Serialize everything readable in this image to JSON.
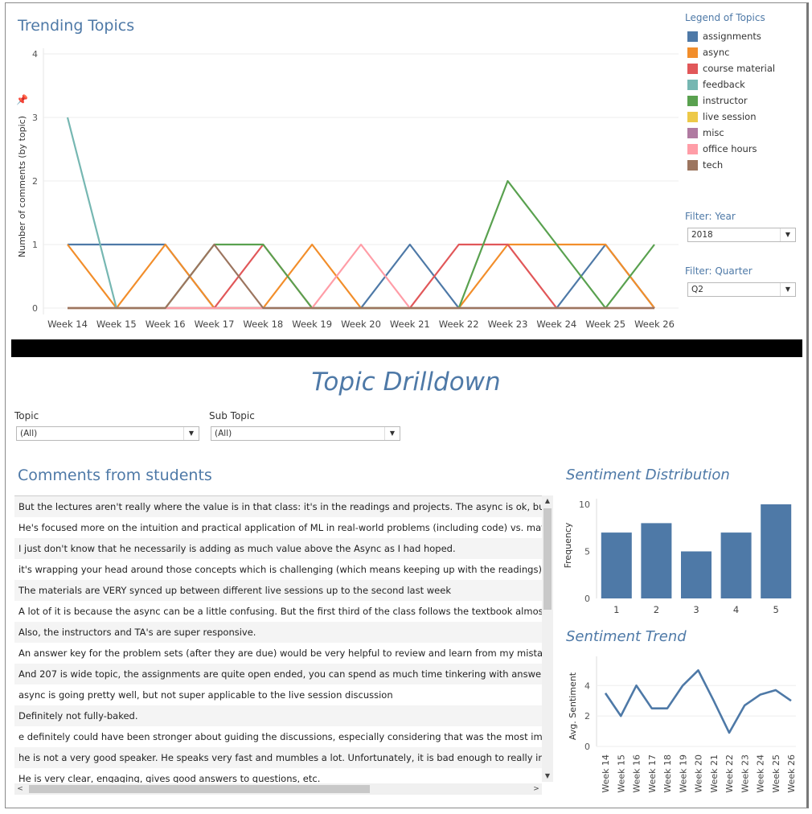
{
  "trending": {
    "title": "Trending Topics"
  },
  "legend": {
    "title": "Legend of Topics",
    "items": [
      {
        "label": "assignments",
        "color": "#4e79a7"
      },
      {
        "label": "async",
        "color": "#f28e2b"
      },
      {
        "label": "course material",
        "color": "#e15759"
      },
      {
        "label": "feedback",
        "color": "#76b7b2"
      },
      {
        "label": "instructor",
        "color": "#59a14f"
      },
      {
        "label": "live session",
        "color": "#edc948"
      },
      {
        "label": "misc",
        "color": "#b07aa1"
      },
      {
        "label": "office hours",
        "color": "#ff9da7"
      },
      {
        "label": "tech",
        "color": "#9c755f"
      }
    ]
  },
  "filters": {
    "year": {
      "label": "Filter: Year",
      "value": "2018"
    },
    "quarter": {
      "label": "Filter: Quarter",
      "value": "Q2"
    }
  },
  "drilldown": {
    "title": "Topic Drilldown",
    "topic": {
      "label": "Topic",
      "value": "(All)"
    },
    "subtopic": {
      "label": "Sub Topic",
      "value": "(All)"
    }
  },
  "comments": {
    "title": "Comments from students",
    "rows": [
      "But the lectures aren't really where the value is in that class: it's in the readings and projects. The async is ok, but not",
      "He's focused more on the intuition and practical application of ML in real-world problems (including code) vs. math/theory",
      "I just don't know that he necessarily is adding as much value above the Async as I had hoped.",
      "it's wrapping your head around those concepts which is challenging (which means keeping up with the readings)",
      "The materials are VERY synced up between different live sessions up to the second last week",
      "A lot of it is because the async can be a little confusing. But the first third of the class follows the textbook almost exactly",
      "Also, the instructors and TA's are super responsive.",
      "An answer key for the problem sets (after they are due) would be very helpful to review and learn from my mistakes",
      "And 207 is wide topic, the assignments are quite open ended, you can spend as much time tinkering with answer as you want",
      "async is going pretty well, but not super applicable to the live session discussion",
      "Definitely not fully-baked.",
      "e definitely could have been stronger about guiding the discussions, especially considering that was the most important",
      "he is not a very good speaker. He speaks very fast and mumbles a lot. Unfortunately, it is bad enough to really interfere",
      "He is very clear, engaging, gives good answers to questions, etc."
    ]
  },
  "chart_data": [
    {
      "type": "line",
      "title": "Trending Topics",
      "ylabel": "Number of comments (by topic)",
      "xlabel": "",
      "x": [
        "Week 14",
        "Week 15",
        "Week 16",
        "Week 17",
        "Week 18",
        "Week 19",
        "Week 20",
        "Week 21",
        "Week 22",
        "Week 23",
        "Week 24",
        "Week 25",
        "Week 26"
      ],
      "ylim": [
        0,
        4
      ],
      "yticks": [
        0,
        1,
        2,
        3,
        4
      ],
      "grid": true,
      "legend_position": "right",
      "series": [
        {
          "name": "assignments",
          "color": "#4e79a7",
          "values": [
            1,
            1,
            1,
            0,
            0,
            0,
            0,
            1,
            0,
            0,
            0,
            1,
            0
          ]
        },
        {
          "name": "async",
          "color": "#f28e2b",
          "values": [
            1,
            0,
            1,
            0,
            0,
            1,
            0,
            0,
            0,
            1,
            1,
            1,
            0
          ]
        },
        {
          "name": "course material",
          "color": "#e15759",
          "values": [
            0,
            0,
            0,
            0,
            1,
            0,
            0,
            0,
            1,
            1,
            0,
            0,
            0
          ]
        },
        {
          "name": "feedback",
          "color": "#76b7b2",
          "values": [
            3,
            0,
            0,
            0,
            0,
            0,
            0,
            0,
            0,
            0,
            0,
            0,
            0
          ]
        },
        {
          "name": "instructor",
          "color": "#59a14f",
          "values": [
            0,
            0,
            0,
            1,
            1,
            0,
            0,
            0,
            0,
            2,
            1,
            0,
            1
          ]
        },
        {
          "name": "live session",
          "color": "#edc948",
          "values": [
            0,
            0,
            0,
            0,
            0,
            0,
            0,
            0,
            0,
            0,
            0,
            0,
            0
          ]
        },
        {
          "name": "misc",
          "color": "#b07aa1",
          "values": [
            0,
            0,
            0,
            0,
            0,
            0,
            0,
            0,
            0,
            0,
            0,
            0,
            0
          ]
        },
        {
          "name": "office hours",
          "color": "#ff9da7",
          "values": [
            0,
            0,
            0,
            0,
            0,
            0,
            1,
            0,
            0,
            0,
            0,
            0,
            0
          ]
        },
        {
          "name": "tech",
          "color": "#9c755f",
          "values": [
            0,
            0,
            0,
            1,
            0,
            0,
            0,
            0,
            0,
            0,
            0,
            0,
            0
          ]
        }
      ]
    },
    {
      "type": "bar",
      "title": "Sentiment Distribution",
      "ylabel": "Frequency",
      "xlabel": "",
      "categories": [
        "1",
        "2",
        "3",
        "4",
        "5"
      ],
      "values": [
        7,
        8,
        5,
        7,
        10
      ],
      "ylim": [
        0,
        10
      ],
      "yticks": [
        0,
        5,
        10
      ],
      "color": "#4e79a7"
    },
    {
      "type": "line",
      "title": "Sentiment Trend",
      "ylabel": "Avg. Sentiment",
      "xlabel": "",
      "x": [
        "Week 14",
        "Week 15",
        "Week 16",
        "Week 17",
        "Week 18",
        "Week 19",
        "Week 20",
        "Week 21",
        "Week 22",
        "Week 23",
        "Week 24",
        "Week 25",
        "Week 26"
      ],
      "values": [
        3.5,
        2.0,
        4.0,
        2.5,
        2.5,
        4.0,
        5.0,
        3.0,
        0.9,
        2.7,
        3.4,
        3.7,
        3.0
      ],
      "ylim": [
        0,
        5.6
      ],
      "yticks": [
        0,
        2,
        4
      ],
      "color": "#4e79a7"
    }
  ]
}
